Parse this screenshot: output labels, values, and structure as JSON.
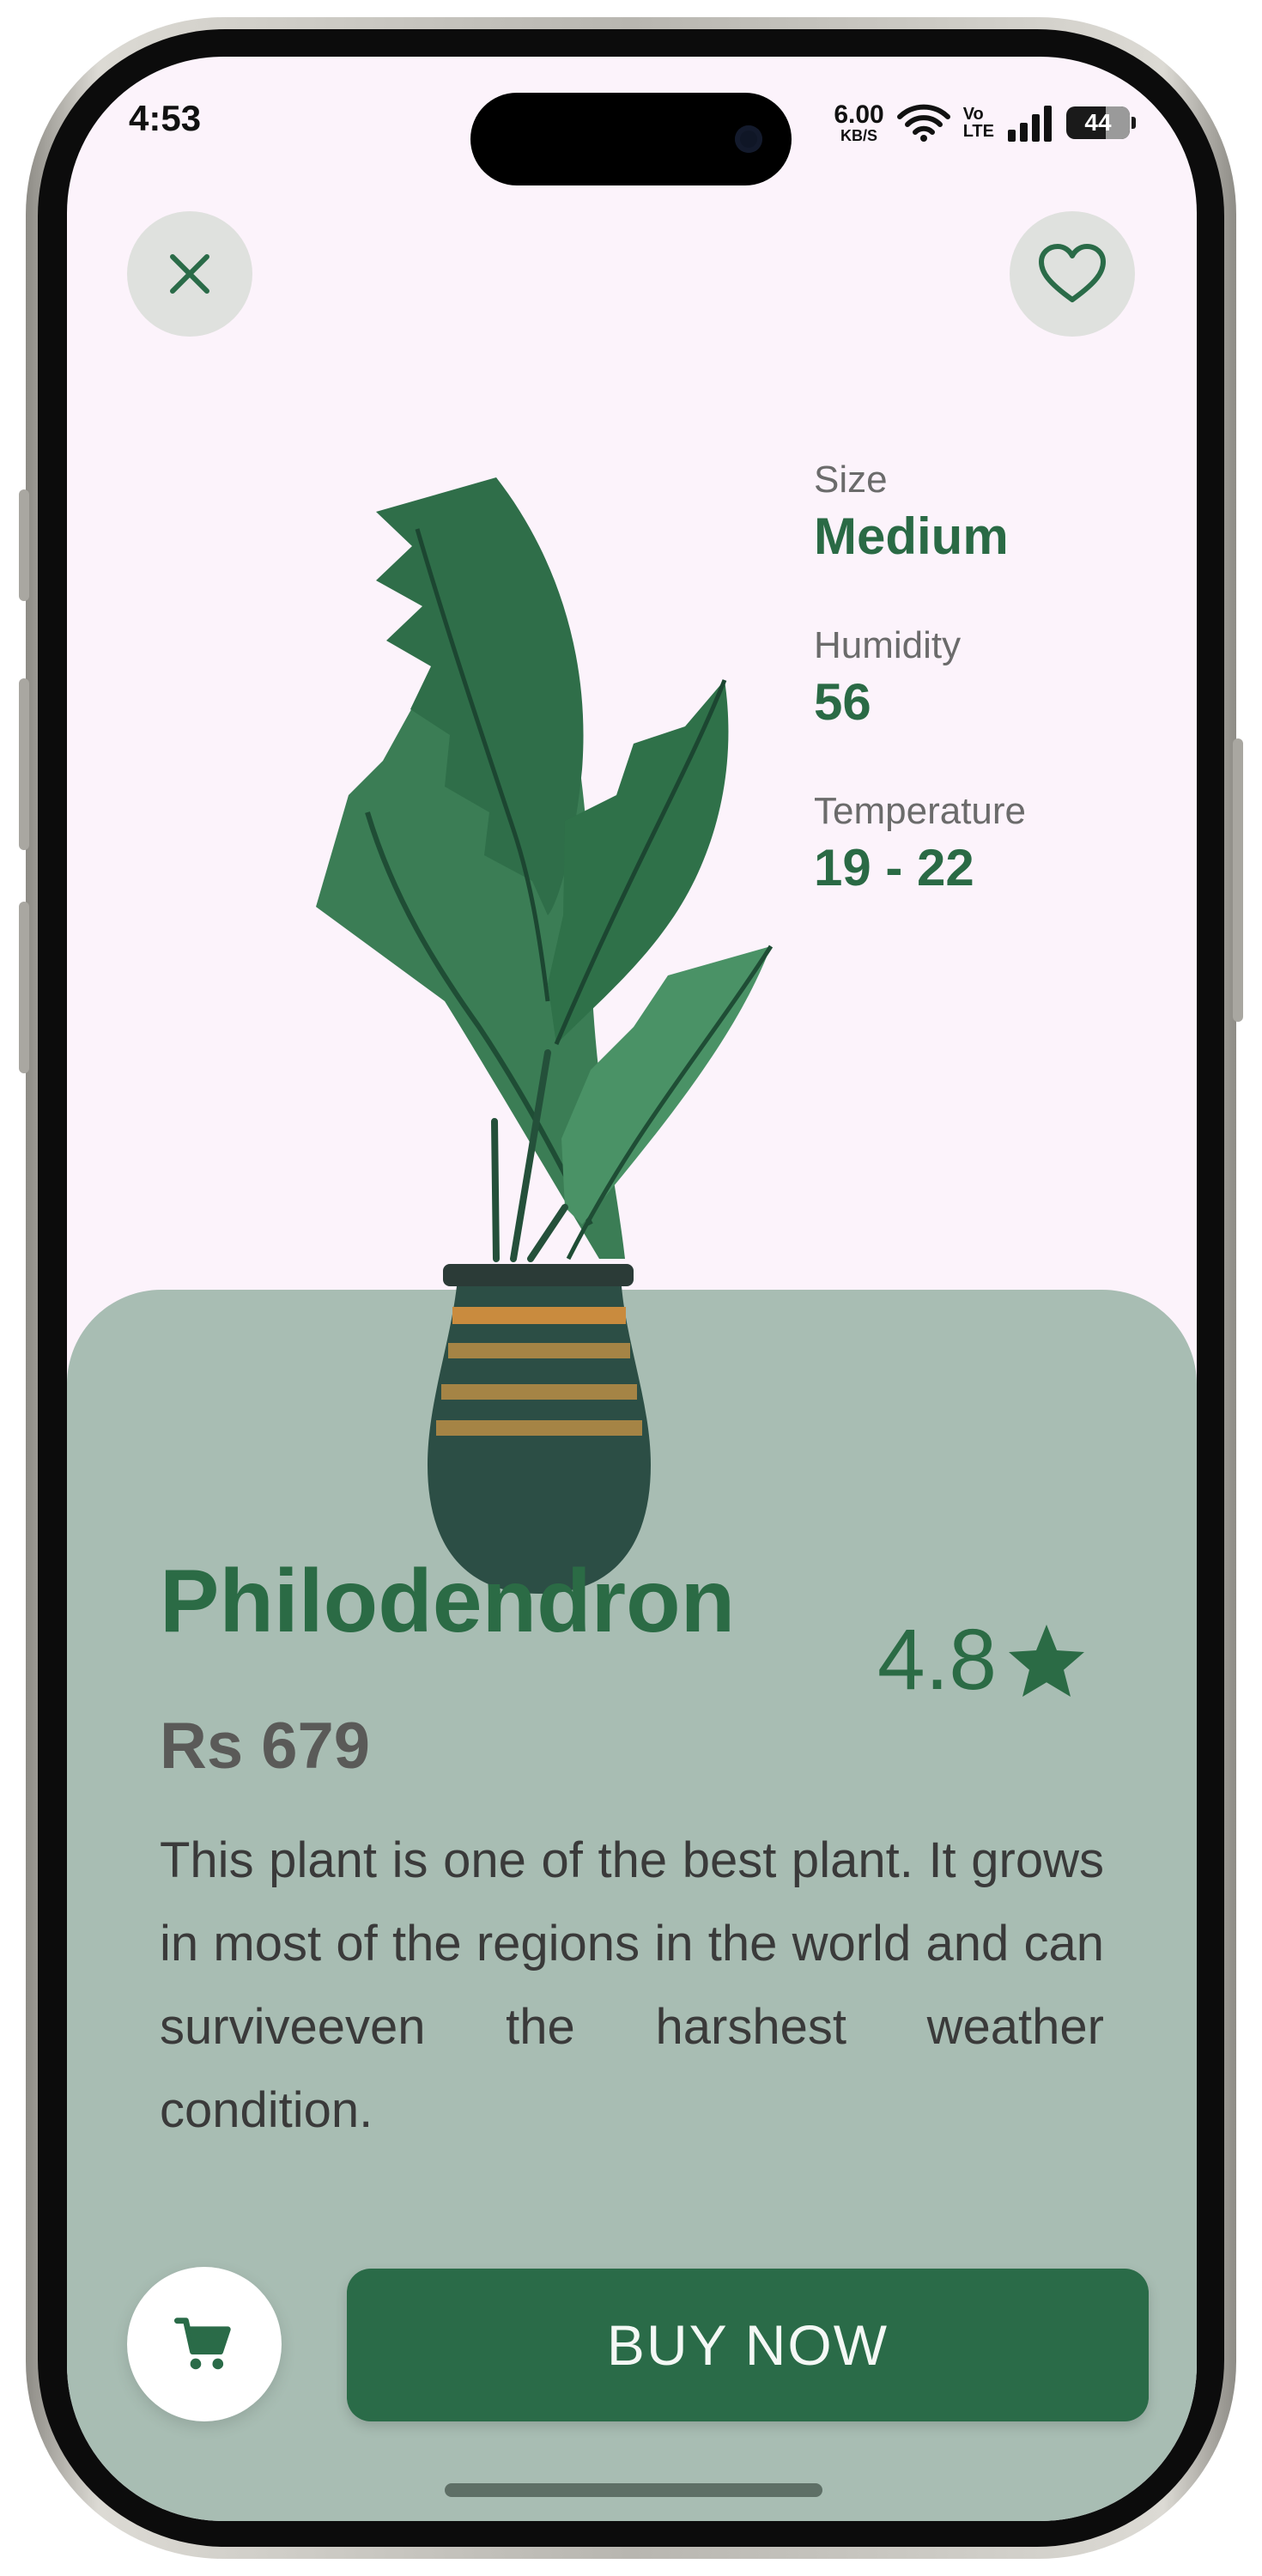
{
  "status_bar": {
    "time": "4:53",
    "net_speed_value": "6.00",
    "net_speed_unit": "KB/S",
    "volte_line1": "Vo",
    "volte_line2": "LTE",
    "battery_level": "44",
    "icons": [
      "wifi-icon",
      "signal-icon",
      "battery-icon"
    ]
  },
  "header": {
    "close_icon": "close-icon",
    "favorite_icon": "heart-outline-icon"
  },
  "specs": [
    {
      "label": "Size",
      "value": "Medium"
    },
    {
      "label": "Humidity",
      "value": "56"
    },
    {
      "label": "Temperature",
      "value": "19 - 22"
    }
  ],
  "product": {
    "name": "Philodendron",
    "rating": "4.8",
    "rating_icon": "star-icon",
    "price": "Rs 679",
    "description": "This plant is one of the best plant. It grows in most of the regions in the world and can surviveeven the harshest weather condition."
  },
  "actions": {
    "cart_icon": "cart-icon",
    "buy_label": "BUY NOW"
  },
  "colors": {
    "background": "#fcf3fb",
    "panel": "#a8bdb3",
    "accent": "#2a6b48",
    "muted_text": "#6b6b6b"
  }
}
